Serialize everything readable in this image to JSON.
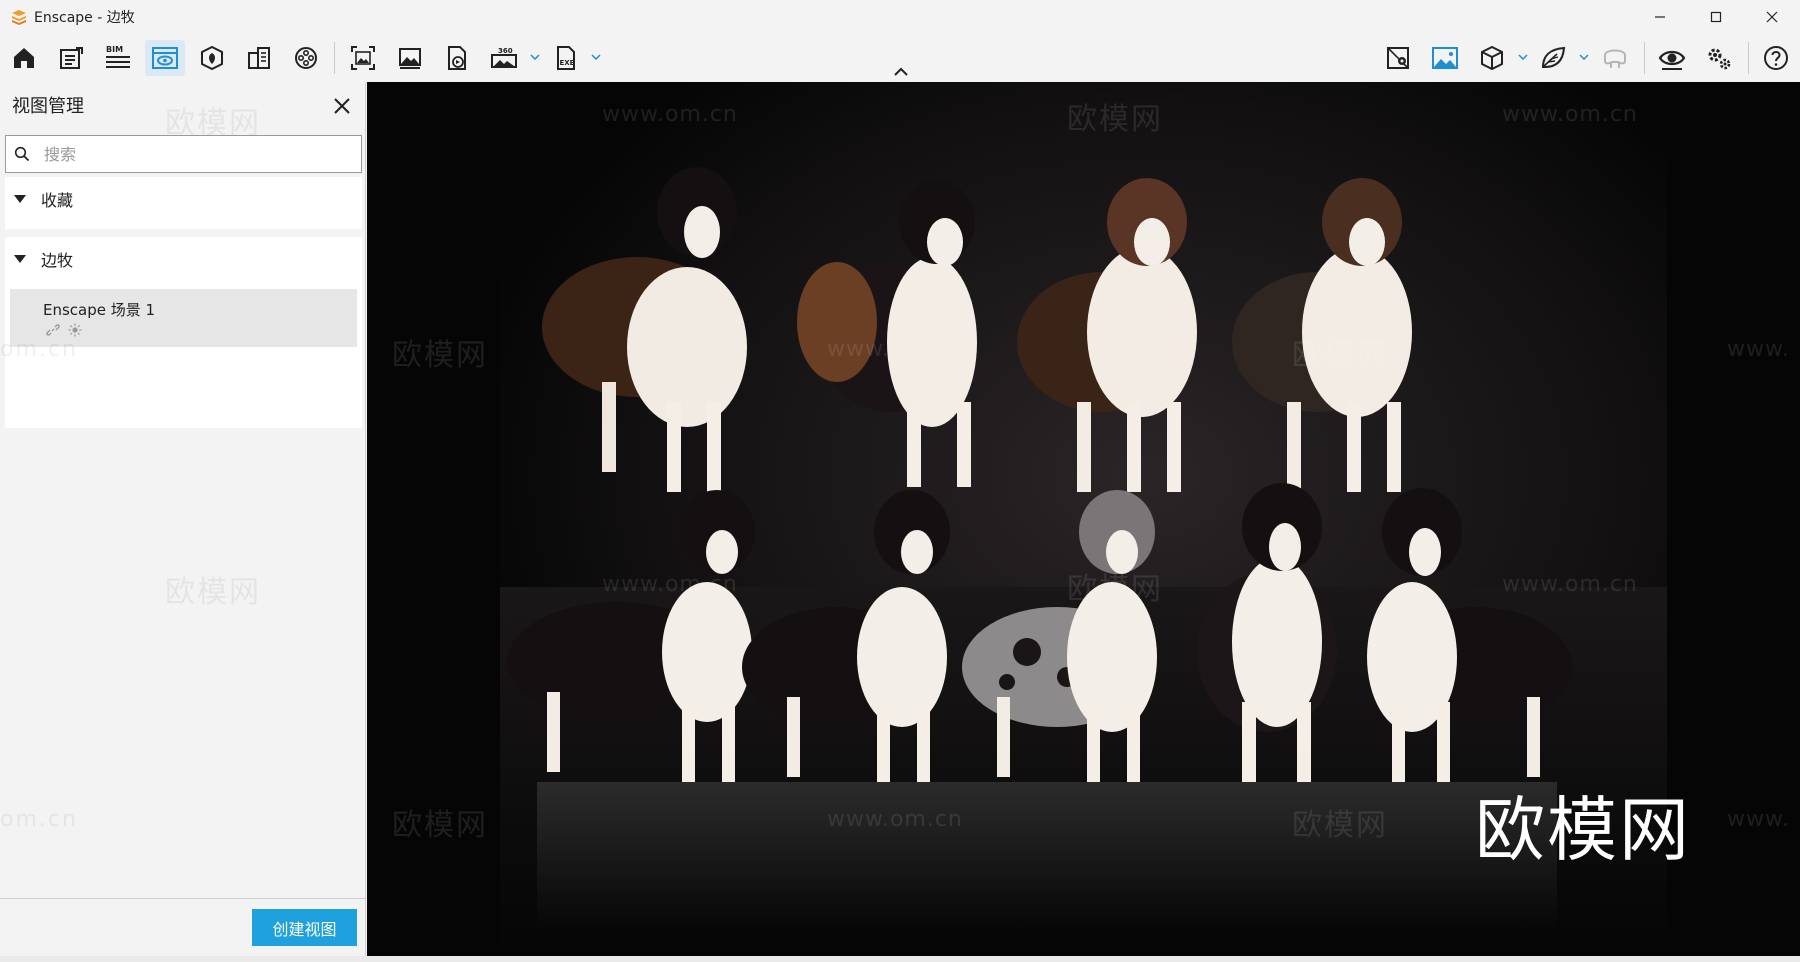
{
  "window": {
    "title": "Enscape - 边牧"
  },
  "toolbar": {
    "buttons": [
      {
        "name": "home",
        "icon": "home-icon"
      },
      {
        "name": "project-notes",
        "icon": "notes-icon"
      },
      {
        "name": "bim",
        "icon": "bim-icon",
        "badge": "BIM"
      },
      {
        "name": "view-management",
        "icon": "eye-window-icon",
        "active": true
      },
      {
        "name": "material",
        "icon": "material-icon"
      },
      {
        "name": "site-context",
        "icon": "buildings-icon"
      },
      {
        "name": "video-editor",
        "icon": "film-reel-icon"
      },
      {
        "name": "screenshot",
        "icon": "screenshot-icon"
      },
      {
        "name": "batch-render",
        "icon": "image-icon"
      },
      {
        "name": "export-web",
        "icon": "file-export-icon"
      },
      {
        "name": "panorama-360",
        "icon": "panorama-360-icon",
        "badge": "360"
      },
      {
        "name": "export-exe",
        "icon": "exe-file-icon",
        "badge": "EXE"
      },
      {
        "name": "map",
        "icon": "map-pin-icon"
      },
      {
        "name": "atmosphere",
        "icon": "landscape-image-icon"
      },
      {
        "name": "asset-library",
        "icon": "cube-icon"
      },
      {
        "name": "materials-editor",
        "icon": "leaf-icon"
      },
      {
        "name": "vr-headset",
        "icon": "vr-headset-icon"
      },
      {
        "name": "visual-settings",
        "icon": "eye-icon"
      },
      {
        "name": "general-settings",
        "icon": "gears-icon"
      },
      {
        "name": "help",
        "icon": "help-icon"
      }
    ]
  },
  "panel": {
    "title": "视图管理",
    "search": {
      "placeholder": "搜索",
      "value": ""
    },
    "sections": [
      {
        "label": "收藏",
        "expanded": true,
        "items": []
      },
      {
        "label": "边牧",
        "expanded": true,
        "items": [
          {
            "name": "Enscape 场景 1",
            "icons": [
              "link-icon",
              "sun-icon"
            ]
          }
        ]
      }
    ],
    "create_button": "创建视图"
  },
  "viewport": {
    "watermark_brand": "欧模网",
    "watermark_url": "www.om.cn",
    "watermark_url_partial": "om.cn",
    "watermark_url_edge": "www.",
    "logo_text": "欧模网"
  },
  "colors": {
    "accent": "#1ea1dc",
    "active_tab_bg": "#dbe9f6",
    "viewport_bg": "#050505"
  }
}
